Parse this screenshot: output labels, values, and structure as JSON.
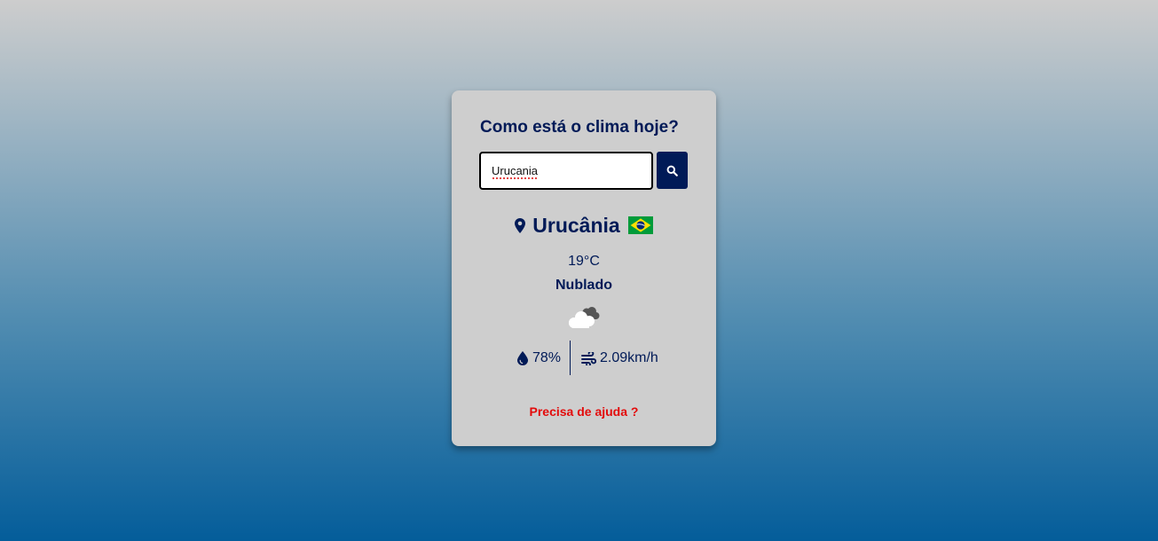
{
  "card": {
    "title": "Como está o clima hoje?",
    "search": {
      "value": "Urucania"
    },
    "search_button_icon": "search-icon"
  },
  "weather": {
    "location_icon": "map-pin-icon",
    "city": "Urucânia",
    "flag_icon": "brazil-flag-icon",
    "temperature": "19°C",
    "description": "Nublado",
    "condition_icon": "cloudy-icon",
    "humidity_icon": "droplet-icon",
    "humidity": "78%",
    "wind_icon": "wind-icon",
    "wind": "2.09km/h"
  },
  "help_link": "Precisa de ajuda ?",
  "colors": {
    "primary": "#001a57",
    "card_background": "#cecece",
    "help_link": "#e30b0b",
    "gradient_top": "#cdcdcd",
    "gradient_bottom": "#045d9a"
  }
}
